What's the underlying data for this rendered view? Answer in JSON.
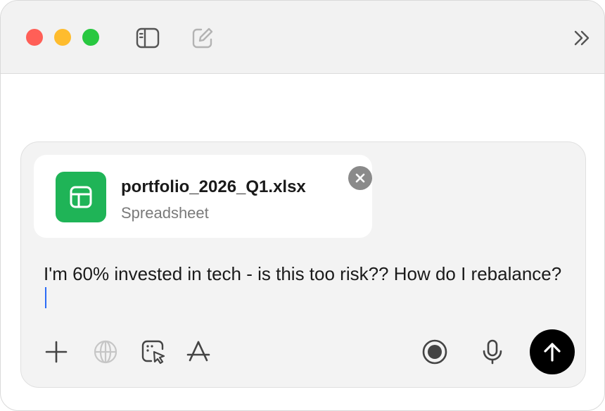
{
  "window": {
    "titlebar": {
      "icons": [
        "close-traffic-light",
        "minimize-traffic-light",
        "maximize-traffic-light",
        "sidebar-toggle-icon",
        "compose-icon",
        "chevron-double-right-icon"
      ]
    }
  },
  "composer": {
    "attachment": {
      "file_name": "portfolio_2026_Q1.xlsx",
      "file_type": "Spreadsheet",
      "icon": "spreadsheet-icon",
      "icon_color": "#1fb457"
    },
    "message": "I'm 60% invested in tech - is this too risk?? How do I rebalance?",
    "toolbar": {
      "left_icons": [
        "plus-icon",
        "globe-icon",
        "select-cursor-icon",
        "app-store-icon"
      ],
      "right_icons": [
        "record-icon",
        "microphone-icon",
        "send-arrow-icon"
      ]
    }
  },
  "colors": {
    "traffic_close": "#ff5f57",
    "traffic_min": "#febc2e",
    "traffic_max": "#28c840",
    "send_button": "#000000",
    "caret": "#2b6bf6"
  }
}
